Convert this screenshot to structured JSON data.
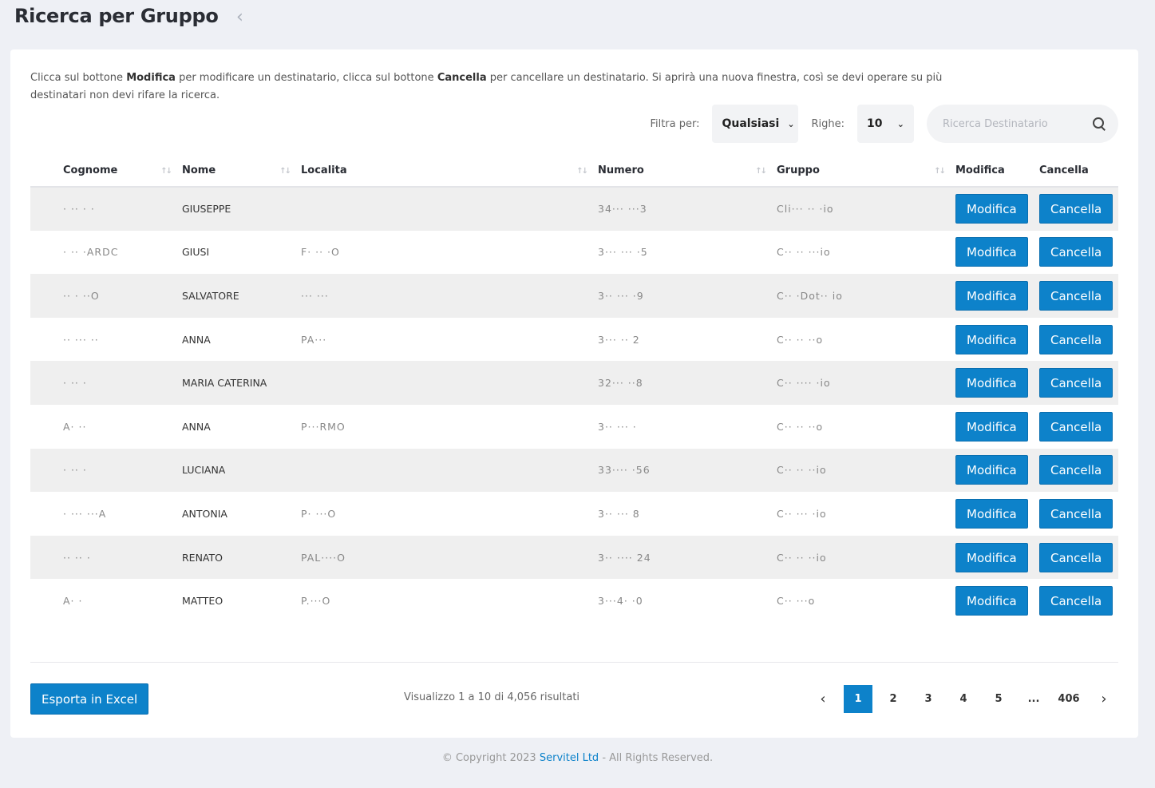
{
  "header": {
    "title": "Ricerca per Gruppo",
    "back_symbol": "‹"
  },
  "intro": {
    "part1": "Clicca sul bottone ",
    "modifica": "Modifica",
    "part2": " per modificare un destinatario, clicca sul bottone ",
    "cancella": "Cancella",
    "part3": " per cancellare un destinatario. Si aprirà una nuova finestra, così se devi operare su più destinatari non devi rifare la ricerca."
  },
  "filters": {
    "filter_label": "Filtra per:",
    "filter_value": "Qualsiasi",
    "rows_label": "Righe:",
    "rows_value": "10",
    "search_placeholder": "Ricerca Destinatario"
  },
  "table": {
    "columns": {
      "cognome": "Cognome",
      "nome": "Nome",
      "localita": "Localita",
      "numero": "Numero",
      "gruppo": "Gruppo",
      "modifica": "Modifica",
      "cancella": "Cancella"
    },
    "sort_symbol": "↑↓",
    "modifica_label": "Modifica",
    "cancella_label": "Cancella",
    "rows": [
      {
        "cognome": "· ··  ·  ·",
        "nome": "GIUSEPPE",
        "localita": "",
        "numero": "34··· ···3",
        "gruppo": "Cli···  ·· ·io"
      },
      {
        "cognome": "· ·· ·ARDC",
        "nome": "GIUSI",
        "localita": "F· ·· ·O",
        "numero": "3··· ··· ·5",
        "gruppo": "C··  ·· ···io"
      },
      {
        "cognome": "··  · ··O",
        "nome": "SALVATORE",
        "localita": "··· ···",
        "numero": "3·· ··· ·9",
        "gruppo": "C·· ·Dot·· io"
      },
      {
        "cognome": "·· ··· ··",
        "nome": "ANNA",
        "localita": "PA···",
        "numero": "3··· ·· 2",
        "gruppo": "C··  ·· ··o"
      },
      {
        "cognome": "· ·· ·",
        "nome": "MARIA CATERINA",
        "localita": "",
        "numero": "32··· ··8",
        "gruppo": "C··  ···· ·io"
      },
      {
        "cognome": "A· ··",
        "nome": "ANNA",
        "localita": "P···RMO",
        "numero": "3·· ··· ·",
        "gruppo": "C··  ·· ··o"
      },
      {
        "cognome": "· ·· ·",
        "nome": "LUCIANA",
        "localita": "",
        "numero": "33···· ·56",
        "gruppo": "C·· ·· ··io"
      },
      {
        "cognome": "· ··· ···A",
        "nome": "ANTONIA",
        "localita": "P· ···O",
        "numero": "3·· ··· 8",
        "gruppo": "C··  ··· ·io"
      },
      {
        "cognome": "·· ·· ·",
        "nome": "RENATO",
        "localita": "PAL····O",
        "numero": "3·· ···· 24",
        "gruppo": "C·· ·· ··io"
      },
      {
        "cognome": "A· ·",
        "nome": "MATTEO",
        "localita": "P.···O",
        "numero": "3···4· ·0",
        "gruppo": "C··  ···o"
      }
    ]
  },
  "bottom": {
    "excel_label": "Esporta in Excel",
    "results_text": "Visualizzo 1 a 10 di 4,056 risultati",
    "pages": [
      "1",
      "2",
      "3",
      "4",
      "5",
      "...",
      "406"
    ],
    "active_page": "1",
    "prev_symbol": "‹",
    "next_symbol": "›"
  },
  "footer": {
    "copyright_prefix": "© Copyright 2023 ",
    "company": "Servitel Ltd",
    "copyright_suffix": " - All Rights Reserved."
  },
  "colors": {
    "primary": "#0d82ca",
    "background": "#eef0f5",
    "row_alt": "#efefef"
  }
}
